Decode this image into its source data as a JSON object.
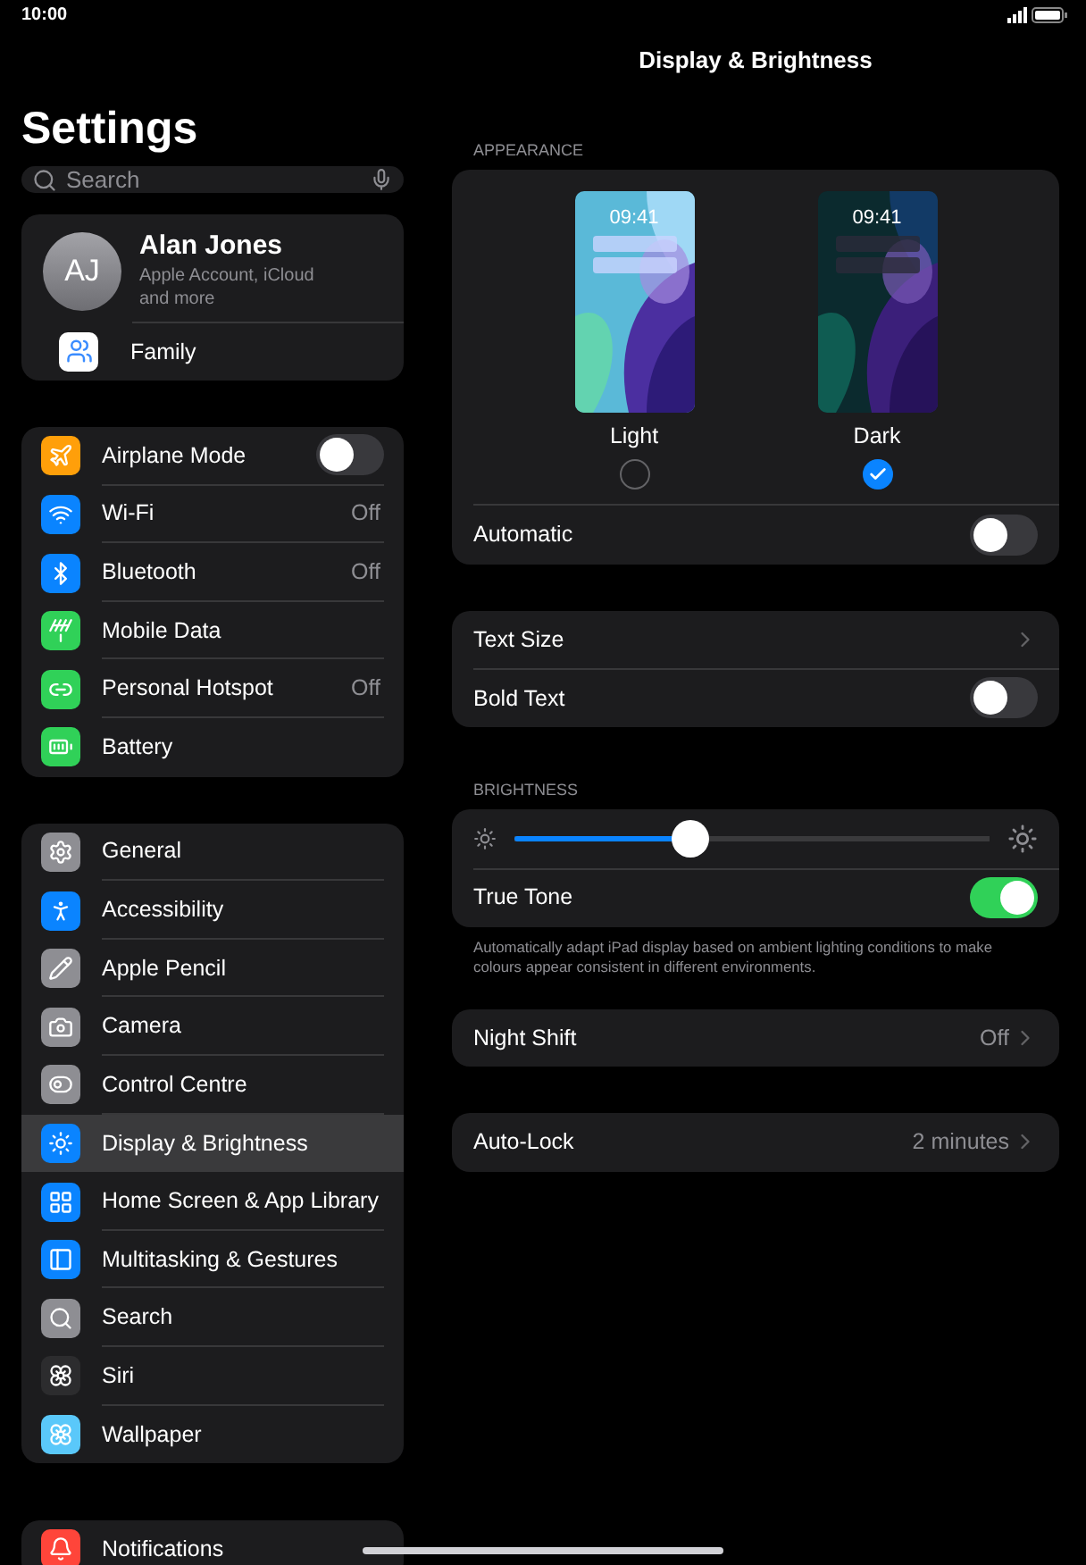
{
  "status_bar": {
    "time": "10:00"
  },
  "sidebar": {
    "title": "Settings",
    "search": {
      "placeholder": "Search"
    },
    "profile": {
      "initials": "AJ",
      "name": "Alan Jones",
      "subtitle": "Apple Account, iCloud and more",
      "family": "Family"
    },
    "groups": [
      [
        {
          "label": "Airplane Mode",
          "color": "#ff9f0a",
          "kind": "toggle",
          "on": false,
          "selected": false
        },
        {
          "label": "Wi-Fi",
          "color": "#0a84ff",
          "kind": "value",
          "value": "Off",
          "selected": false
        },
        {
          "label": "Bluetooth",
          "color": "#0a84ff",
          "kind": "value",
          "value": "Off",
          "selected": false
        },
        {
          "label": "Mobile Data",
          "color": "#30d158",
          "kind": "plain",
          "selected": false
        },
        {
          "label": "Personal Hotspot",
          "color": "#30d158",
          "kind": "value",
          "value": "Off",
          "selected": false
        },
        {
          "label": "Battery",
          "color": "#30d158",
          "kind": "plain",
          "selected": false
        }
      ],
      [
        {
          "label": "General",
          "color": "#8e8e93",
          "kind": "plain",
          "selected": false
        },
        {
          "label": "Accessibility",
          "color": "#0a84ff",
          "kind": "plain",
          "selected": false
        },
        {
          "label": "Apple Pencil",
          "color": "#8e8e93",
          "kind": "plain",
          "selected": false
        },
        {
          "label": "Camera",
          "color": "#8e8e93",
          "kind": "plain",
          "selected": false
        },
        {
          "label": "Control Centre",
          "color": "#8e8e93",
          "kind": "plain",
          "selected": false
        },
        {
          "label": "Display & Brightness",
          "color": "#0a84ff",
          "kind": "plain",
          "selected": true
        },
        {
          "label": "Home Screen & App Library",
          "color": "#0a84ff",
          "kind": "plain",
          "selected": false
        },
        {
          "label": "Multitasking & Gestures",
          "color": "#0a84ff",
          "kind": "plain",
          "selected": false
        },
        {
          "label": "Search",
          "color": "#8e8e93",
          "kind": "plain",
          "selected": false
        },
        {
          "label": "Siri",
          "color": "#2c2c2e",
          "kind": "plain",
          "selected": false
        },
        {
          "label": "Wallpaper",
          "color": "#5ac8fa",
          "kind": "plain",
          "selected": false
        }
      ],
      [
        {
          "label": "Notifications",
          "color": "#ff453a",
          "kind": "plain",
          "selected": false
        }
      ]
    ]
  },
  "detail": {
    "title": "Display & Brightness",
    "appearance": {
      "header": "APPEARANCE",
      "options": [
        {
          "label": "Light",
          "clock": "09:41",
          "selected": false
        },
        {
          "label": "Dark",
          "clock": "09:41",
          "selected": true
        }
      ],
      "automatic": {
        "label": "Automatic",
        "on": false
      }
    },
    "text_group": [
      {
        "label": "Text Size",
        "kind": "link"
      },
      {
        "label": "Bold Text",
        "kind": "toggle",
        "on": false
      }
    ],
    "brightness": {
      "header": "BRIGHTNESS",
      "level": 0.37,
      "true_tone": {
        "label": "True Tone",
        "on": true
      },
      "footnote": "Automatically adapt iPad display based on ambient lighting conditions to make colours appear consistent in different environments."
    },
    "night_shift": {
      "label": "Night Shift",
      "value": "Off"
    },
    "auto_lock": {
      "label": "Auto-Lock",
      "value": "2 minutes"
    }
  }
}
